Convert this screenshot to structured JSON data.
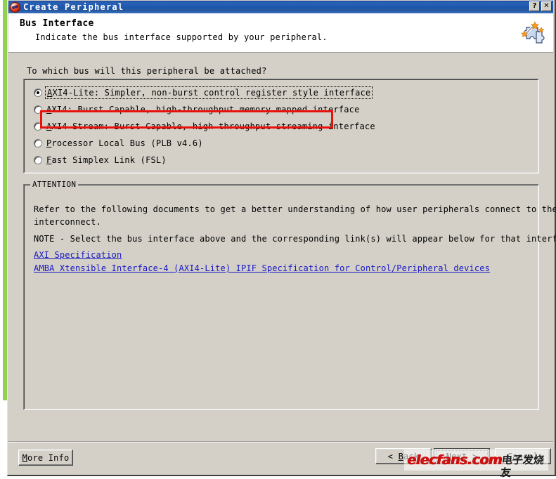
{
  "window": {
    "title": "Create Peripheral",
    "icon": "xilinx-logo-icon",
    "help_button": "?",
    "close_button": "✕"
  },
  "header": {
    "title": "Bus Interface",
    "subtitle": "Indicate the bus interface supported by your peripheral.",
    "art": "puzzle-wand-icon"
  },
  "main": {
    "question": "To which bus will this peripheral be attached?",
    "radio_options": [
      {
        "accel": "A",
        "rest": "XI4-Lite: Simpler, non-burst control register style interface",
        "full": "AXI4-Lite: Simpler, non-burst control register style interface",
        "checked": true,
        "focused": true,
        "highlighted": true
      },
      {
        "accel": "A",
        "rest": "XI4: Burst Capable, high-throughput memory mapped interface",
        "full": "AXI4: Burst Capable, high-throughput memory mapped interface",
        "checked": false,
        "focused": false,
        "highlighted": false
      },
      {
        "accel": "A",
        "rest": "XI4-Stream: Burst Capable, high-throughput streaming interface",
        "full": "AXI4-Stream: Burst Capable, high-throughput streaming interface",
        "checked": false,
        "focused": false,
        "highlighted": false
      },
      {
        "accel": "P",
        "rest": "rocessor Local Bus (PLB v4.6)",
        "full": "Processor Local Bus (PLB v4.6)",
        "checked": false,
        "focused": false,
        "highlighted": false
      },
      {
        "accel": "F",
        "rest": "ast Simplex Link (FSL)",
        "full": "Fast Simplex Link (FSL)",
        "checked": false,
        "focused": false,
        "highlighted": false
      }
    ]
  },
  "attention": {
    "legend": "ATTENTION",
    "lines": [
      "Refer to the following documents to get a better understanding of how user peripherals connect to the AXI bus",
      "interconnect.",
      "NOTE - Select the bus interface above and the corresponding link(s) will appear below for that interface."
    ],
    "links": [
      "AXI Specification",
      "AMBA Xtensible Interface-4 (AXI4-Lite) IPIF Specification for Control/Peripheral devices"
    ]
  },
  "footer": {
    "more_info": {
      "accel": "M",
      "rest": "ore Info",
      "full": "More Info"
    },
    "back": {
      "prefix": "< ",
      "accel": "B",
      "rest": "ack",
      "full": "< Back"
    },
    "next": {
      "accel": "N",
      "rest": "ext >",
      "full": "Next >"
    },
    "cancel": {
      "accel": "C",
      "rest": "ancel",
      "full": "Cancel"
    }
  },
  "watermark": {
    "english": "elecfans.com",
    "chinese": "电子发烧友"
  },
  "colors": {
    "titlebar_blue": "#1f56ad",
    "dialog_face": "#d4d0c8",
    "highlight_red": "#e8120c",
    "link_blue": "#1717c4",
    "desktop_green": "#92d050",
    "watermark_red": "#cc1111"
  }
}
